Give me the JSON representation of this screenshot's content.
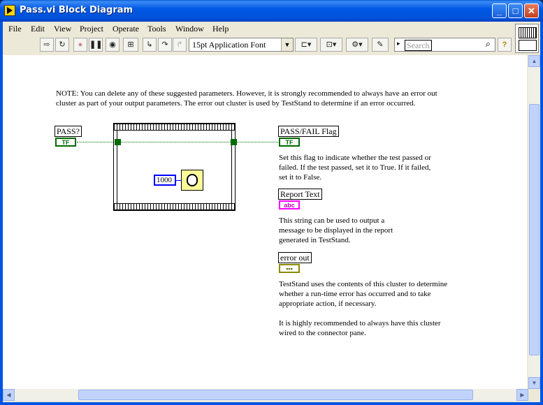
{
  "window": {
    "title": "Pass.vi Block Diagram"
  },
  "menu": [
    "File",
    "Edit",
    "View",
    "Project",
    "Operate",
    "Tools",
    "Window",
    "Help"
  ],
  "toolbar": {
    "font": "15pt Application Font",
    "search_placeholder": "Search"
  },
  "note": "NOTE: You can delete any of these suggested parameters.  However, it is strongly recommended to always have an error out cluster as part of your output parameters.  The error out cluster is used by TestStand to determine if an error occurred.",
  "diagram": {
    "pass_label": "PASS?",
    "bool_term": "TF",
    "wait_const": "1000",
    "passfail_label": "PASS/FAIL Flag",
    "passfail_desc": "Set this flag to indicate whether the test passed or failed.  If the test passed, set it to True.  If it failed, set it to False.",
    "report_label": "Report Text",
    "str_term": "abc",
    "report_desc": "This string can be used to output a message to be displayed in the report generated in TestStand.",
    "error_label": "error out",
    "error_desc1": "TestStand uses the contents of this cluster to determine whether a run-time error has occurred and to take appropriate action, if necessary.",
    "error_desc2": "It is highly recommended to always have this cluster wired to the connector pane."
  }
}
